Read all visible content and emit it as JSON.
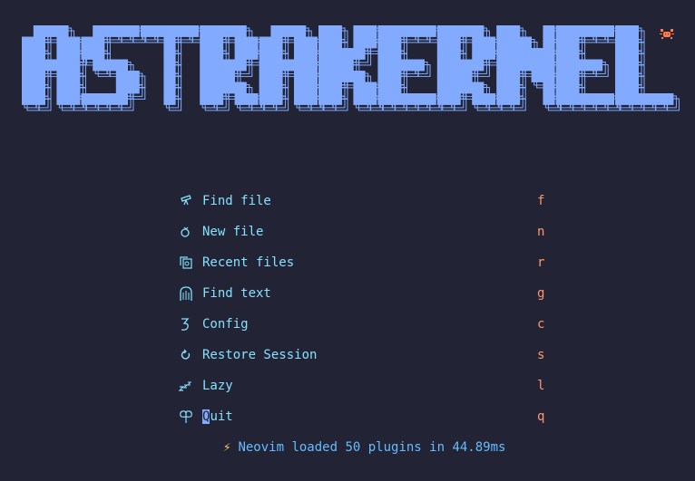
{
  "theme": {
    "background": "#222436",
    "logo_color": "#82aaff",
    "label_color": "#86e1fc",
    "key_color": "#ff966c",
    "footer_color": "#65bcff",
    "bolt_color": "#ffc777",
    "crab_color": "#ff7a45"
  },
  "header": {
    "logo_text": "ASTRAKERNEL",
    "badge_icon": "crab-icon"
  },
  "menu": [
    {
      "icon": "telescope-icon",
      "label": "Find file",
      "key": "f"
    },
    {
      "icon": "new-file-icon",
      "label": "New file",
      "key": "n"
    },
    {
      "icon": "recent-files-icon",
      "label": "Recent files",
      "key": "r"
    },
    {
      "icon": "ghost-icon",
      "label": "Find text",
      "key": "g"
    },
    {
      "icon": "config-gear-icon",
      "label": "Config",
      "key": "c"
    },
    {
      "icon": "restore-icon",
      "label": "Restore Session",
      "key": "s"
    },
    {
      "icon": "sleep-icon",
      "label": "Lazy",
      "key": "l"
    },
    {
      "icon": "quit-icon",
      "label": "Quit",
      "key": "q"
    }
  ],
  "footer": {
    "icon": "lightning-icon",
    "text": "Neovim loaded 50 plugins in 44.89ms"
  }
}
